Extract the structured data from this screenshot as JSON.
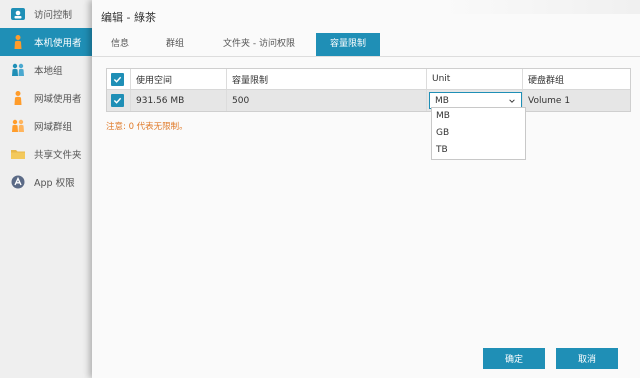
{
  "sidebar": {
    "items": [
      {
        "label": "访问控制",
        "icon": "access-control-icon"
      },
      {
        "label": "本机使用者",
        "icon": "local-user-icon",
        "active": true
      },
      {
        "label": "本地组",
        "icon": "local-group-icon"
      },
      {
        "label": "网域使用者",
        "icon": "domain-user-icon"
      },
      {
        "label": "网域群组",
        "icon": "domain-group-icon"
      },
      {
        "label": "共享文件夹",
        "icon": "shared-folder-icon"
      },
      {
        "label": "App 权限",
        "icon": "app-permission-icon"
      }
    ]
  },
  "dialog": {
    "title": "编辑 - 綠茶",
    "tabs": [
      {
        "label": "信息"
      },
      {
        "label": "群组"
      },
      {
        "label": "文件夹 - 访问权限"
      },
      {
        "label": "容量限制",
        "active": true
      }
    ]
  },
  "table": {
    "headers": [
      "使用空间",
      "容量限制",
      "Unit",
      "硬盘群组"
    ],
    "row": {
      "used": "931.56 MB",
      "quota": "500",
      "unit": "MB",
      "volume": "Volume 1"
    }
  },
  "unit_dropdown": {
    "options": [
      "MB",
      "GB",
      "TB"
    ]
  },
  "note": "注意: 0 代表无限制。",
  "buttons": {
    "ok": "确定",
    "cancel": "取消"
  },
  "colors": {
    "accent": "#1f8fb6",
    "note": "#e07b2a"
  }
}
